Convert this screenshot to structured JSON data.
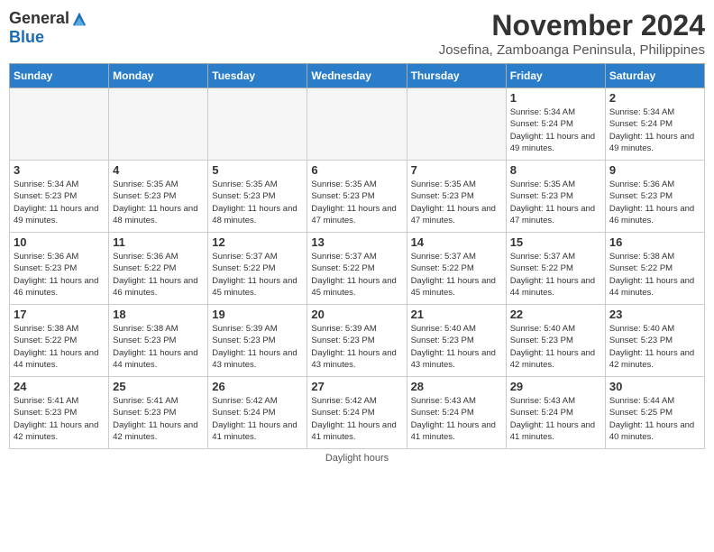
{
  "logo": {
    "general": "General",
    "blue": "Blue"
  },
  "title": {
    "month": "November 2024",
    "location": "Josefina, Zamboanga Peninsula, Philippines"
  },
  "weekdays": [
    "Sunday",
    "Monday",
    "Tuesday",
    "Wednesday",
    "Thursday",
    "Friday",
    "Saturday"
  ],
  "weeks": [
    [
      {
        "day": "",
        "info": ""
      },
      {
        "day": "",
        "info": ""
      },
      {
        "day": "",
        "info": ""
      },
      {
        "day": "",
        "info": ""
      },
      {
        "day": "",
        "info": ""
      },
      {
        "day": "1",
        "info": "Sunrise: 5:34 AM\nSunset: 5:24 PM\nDaylight: 11 hours and 49 minutes."
      },
      {
        "day": "2",
        "info": "Sunrise: 5:34 AM\nSunset: 5:24 PM\nDaylight: 11 hours and 49 minutes."
      }
    ],
    [
      {
        "day": "3",
        "info": "Sunrise: 5:34 AM\nSunset: 5:23 PM\nDaylight: 11 hours and 49 minutes."
      },
      {
        "day": "4",
        "info": "Sunrise: 5:35 AM\nSunset: 5:23 PM\nDaylight: 11 hours and 48 minutes."
      },
      {
        "day": "5",
        "info": "Sunrise: 5:35 AM\nSunset: 5:23 PM\nDaylight: 11 hours and 48 minutes."
      },
      {
        "day": "6",
        "info": "Sunrise: 5:35 AM\nSunset: 5:23 PM\nDaylight: 11 hours and 47 minutes."
      },
      {
        "day": "7",
        "info": "Sunrise: 5:35 AM\nSunset: 5:23 PM\nDaylight: 11 hours and 47 minutes."
      },
      {
        "day": "8",
        "info": "Sunrise: 5:35 AM\nSunset: 5:23 PM\nDaylight: 11 hours and 47 minutes."
      },
      {
        "day": "9",
        "info": "Sunrise: 5:36 AM\nSunset: 5:23 PM\nDaylight: 11 hours and 46 minutes."
      }
    ],
    [
      {
        "day": "10",
        "info": "Sunrise: 5:36 AM\nSunset: 5:23 PM\nDaylight: 11 hours and 46 minutes."
      },
      {
        "day": "11",
        "info": "Sunrise: 5:36 AM\nSunset: 5:22 PM\nDaylight: 11 hours and 46 minutes."
      },
      {
        "day": "12",
        "info": "Sunrise: 5:37 AM\nSunset: 5:22 PM\nDaylight: 11 hours and 45 minutes."
      },
      {
        "day": "13",
        "info": "Sunrise: 5:37 AM\nSunset: 5:22 PM\nDaylight: 11 hours and 45 minutes."
      },
      {
        "day": "14",
        "info": "Sunrise: 5:37 AM\nSunset: 5:22 PM\nDaylight: 11 hours and 45 minutes."
      },
      {
        "day": "15",
        "info": "Sunrise: 5:37 AM\nSunset: 5:22 PM\nDaylight: 11 hours and 44 minutes."
      },
      {
        "day": "16",
        "info": "Sunrise: 5:38 AM\nSunset: 5:22 PM\nDaylight: 11 hours and 44 minutes."
      }
    ],
    [
      {
        "day": "17",
        "info": "Sunrise: 5:38 AM\nSunset: 5:22 PM\nDaylight: 11 hours and 44 minutes."
      },
      {
        "day": "18",
        "info": "Sunrise: 5:38 AM\nSunset: 5:23 PM\nDaylight: 11 hours and 44 minutes."
      },
      {
        "day": "19",
        "info": "Sunrise: 5:39 AM\nSunset: 5:23 PM\nDaylight: 11 hours and 43 minutes."
      },
      {
        "day": "20",
        "info": "Sunrise: 5:39 AM\nSunset: 5:23 PM\nDaylight: 11 hours and 43 minutes."
      },
      {
        "day": "21",
        "info": "Sunrise: 5:40 AM\nSunset: 5:23 PM\nDaylight: 11 hours and 43 minutes."
      },
      {
        "day": "22",
        "info": "Sunrise: 5:40 AM\nSunset: 5:23 PM\nDaylight: 11 hours and 42 minutes."
      },
      {
        "day": "23",
        "info": "Sunrise: 5:40 AM\nSunset: 5:23 PM\nDaylight: 11 hours and 42 minutes."
      }
    ],
    [
      {
        "day": "24",
        "info": "Sunrise: 5:41 AM\nSunset: 5:23 PM\nDaylight: 11 hours and 42 minutes."
      },
      {
        "day": "25",
        "info": "Sunrise: 5:41 AM\nSunset: 5:23 PM\nDaylight: 11 hours and 42 minutes."
      },
      {
        "day": "26",
        "info": "Sunrise: 5:42 AM\nSunset: 5:24 PM\nDaylight: 11 hours and 41 minutes."
      },
      {
        "day": "27",
        "info": "Sunrise: 5:42 AM\nSunset: 5:24 PM\nDaylight: 11 hours and 41 minutes."
      },
      {
        "day": "28",
        "info": "Sunrise: 5:43 AM\nSunset: 5:24 PM\nDaylight: 11 hours and 41 minutes."
      },
      {
        "day": "29",
        "info": "Sunrise: 5:43 AM\nSunset: 5:24 PM\nDaylight: 11 hours and 41 minutes."
      },
      {
        "day": "30",
        "info": "Sunrise: 5:44 AM\nSunset: 5:25 PM\nDaylight: 11 hours and 40 minutes."
      }
    ]
  ],
  "footer": "Daylight hours"
}
